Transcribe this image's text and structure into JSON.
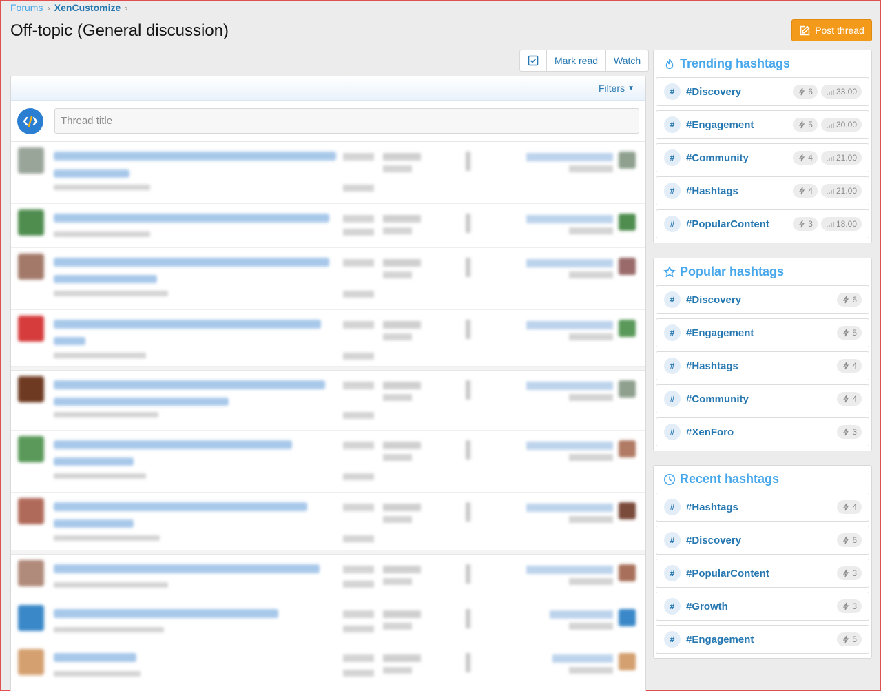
{
  "breadcrumb": {
    "forums": "Forums",
    "current": "XenCustomize"
  },
  "page_title": "Off-topic (General discussion)",
  "post_thread_label": "Post thread",
  "actions": {
    "mark_read": "Mark read",
    "watch": "Watch"
  },
  "filters_label": "Filters",
  "quick_thread": {
    "placeholder": "Thread title"
  },
  "colors": {
    "accent": "#2577b1",
    "link": "#47a7eb",
    "button": "#f39a1b"
  },
  "trending": {
    "title": "Trending hashtags",
    "items": [
      {
        "tag": "#Discovery",
        "uses": "6",
        "score": "33.00"
      },
      {
        "tag": "#Engagement",
        "uses": "5",
        "score": "30.00"
      },
      {
        "tag": "#Community",
        "uses": "4",
        "score": "21.00"
      },
      {
        "tag": "#Hashtags",
        "uses": "4",
        "score": "21.00"
      },
      {
        "tag": "#PopularContent",
        "uses": "3",
        "score": "18.00"
      }
    ]
  },
  "popular": {
    "title": "Popular hashtags",
    "items": [
      {
        "tag": "#Discovery",
        "uses": "6"
      },
      {
        "tag": "#Engagement",
        "uses": "5"
      },
      {
        "tag": "#Hashtags",
        "uses": "4"
      },
      {
        "tag": "#Community",
        "uses": "4"
      },
      {
        "tag": "#XenForo",
        "uses": "3"
      }
    ]
  },
  "recent": {
    "title": "Recent hashtags",
    "items": [
      {
        "tag": "#Hashtags",
        "uses": "4"
      },
      {
        "tag": "#Discovery",
        "uses": "6"
      },
      {
        "tag": "#PopularContent",
        "uses": "3"
      },
      {
        "tag": "#Growth",
        "uses": "3"
      },
      {
        "tag": "#Engagement",
        "uses": "5"
      }
    ]
  }
}
